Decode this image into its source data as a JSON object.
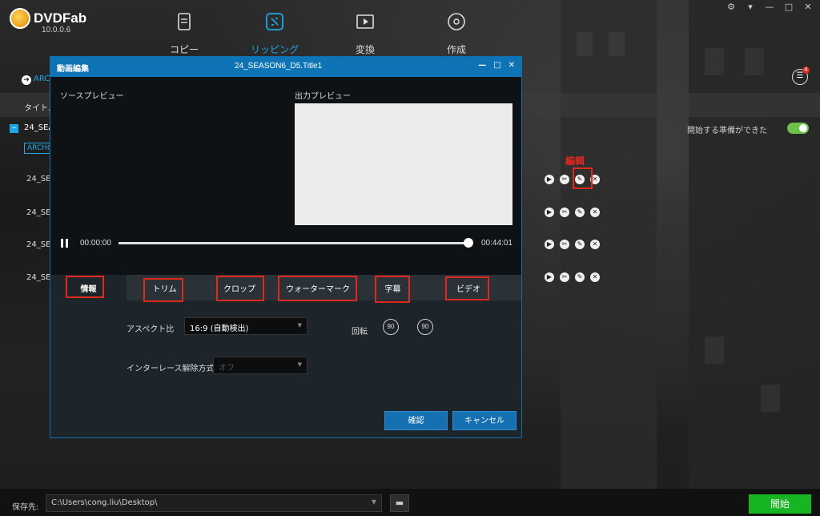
{
  "app": {
    "logo_text": "DVDFab",
    "version": "10.0.0.6"
  },
  "nav": [
    {
      "label": "コピー",
      "icon": "document-icon"
    },
    {
      "label": "リッピング",
      "icon": "ripping-icon",
      "active": true
    },
    {
      "label": "変換",
      "icon": "video-convert-icon"
    },
    {
      "label": "作成",
      "icon": "disc-create-icon"
    }
  ],
  "subbar": {
    "arch_link": "ARCH",
    "badge_count": "4"
  },
  "list": {
    "header_title": "タイトル",
    "title_name": "24_SEA",
    "ready_text": "開始する準備ができた",
    "arch_tag": "ARCHO",
    "rows": [
      "24_SE",
      "24_SE",
      "24_SE",
      "24_SE"
    ],
    "edit_annotation": "編輯"
  },
  "dialog": {
    "title_left": "動画編集",
    "title_center": "24_SEASON6_D5.Title1",
    "source_preview_label": "ソースプレビュー",
    "output_preview_label": "出力プレビュー",
    "time_start": "00:00:00",
    "time_end": "00:44:01",
    "progress": 1.0,
    "tabs": [
      {
        "label": "情報",
        "active": true
      },
      {
        "label": "トリム"
      },
      {
        "label": "クロップ"
      },
      {
        "label": "ウォーターマーク"
      },
      {
        "label": "字幕"
      },
      {
        "label": "ビデオ"
      }
    ],
    "aspect_label": "アスペクト比",
    "aspect_value": "16:9 (自動検出)",
    "deinterlace_label": "インターレース解除方式",
    "deinterlace_value": "オフ",
    "rotate_label": "回転",
    "rotate_left": "90",
    "rotate_right": "90",
    "ok_label": "確認",
    "cancel_label": "キャンセル"
  },
  "bottom": {
    "save_label": "保存先:",
    "save_path": "C:\\Users\\cong.liu\\Desktop\\",
    "start_label": "開始"
  },
  "colors": {
    "accent": "#1fa6e6",
    "dialog_title": "#0e74b6",
    "highlight": "#e0281c",
    "start": "#18b522"
  }
}
